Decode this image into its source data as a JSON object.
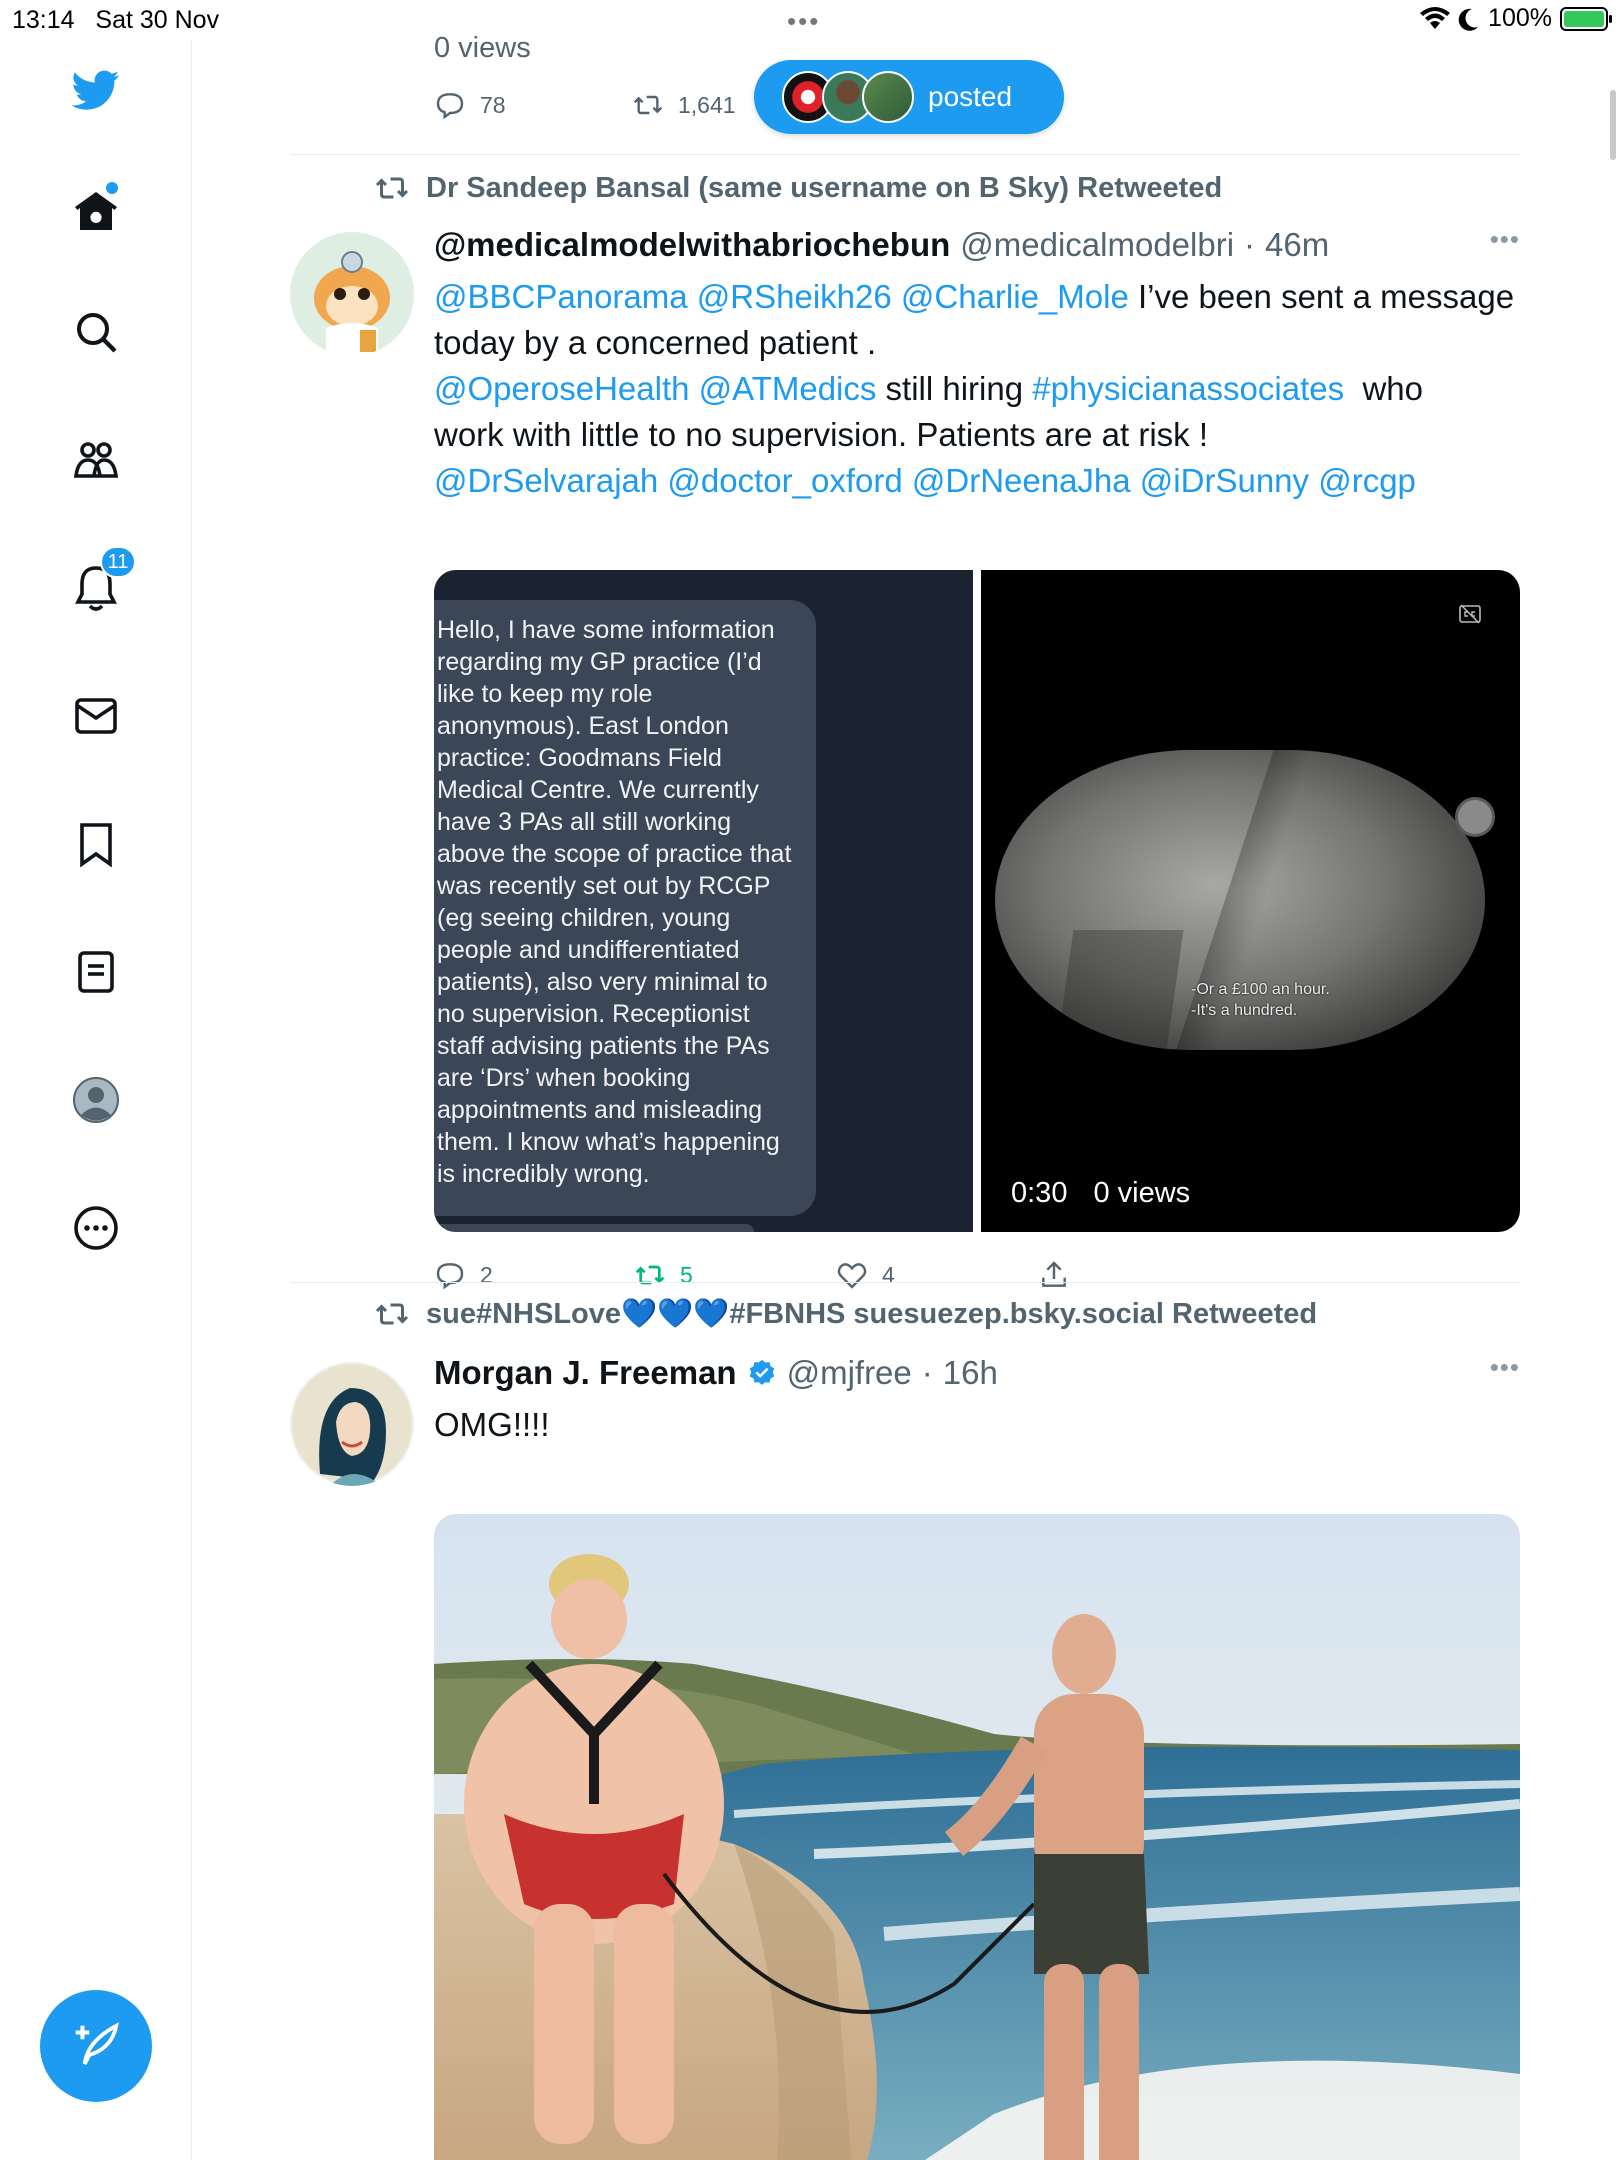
{
  "status_bar": {
    "time": "13:14",
    "date": "Sat 30 Nov",
    "battery": "100%"
  },
  "sidebar": {
    "notifications_badge": "11",
    "items": [
      "twitter-logo",
      "home-icon",
      "search-icon",
      "communities-icon",
      "bell-icon",
      "mail-icon",
      "bookmark-icon",
      "lists-icon",
      "profile-icon",
      "more-icon",
      "compose-icon"
    ]
  },
  "top_tweet": {
    "views": "0 views",
    "replies": "78",
    "retweets": "1,641"
  },
  "posted_pill": {
    "label": "posted"
  },
  "tweets": [
    {
      "retweeted_by": "Dr Sandeep Bansal (same username on B Sky) Retweeted",
      "name": "@medicalmodelwithabriochebun",
      "handle": "@medicalmodelbri",
      "age": "46m",
      "text_lines": [
        [
          "@BBCPanorama @RSheikh26 @Charlie_Mole",
          " I’ve been sent a message"
        ],
        [
          "today by a concerned patient ."
        ],
        [
          "@OperoseHealth @ATMedics",
          " still hiring ",
          "#physicianassociates",
          "  who"
        ],
        [
          "work with little to no supervision. Patients are at risk !"
        ],
        [
          "@DrSelvarajah @doctor_oxford @DrNeenaJha @iDrSunny @rcgp"
        ]
      ],
      "message_text": "Hello, I have some information regarding my GP practice (I’d like to keep my role anonymous). East London practice: Goodmans Field Medical Centre. We currently have 3 PAs all still working above the scope of practice that was recently set out by RCGP (eg seeing children, young people and undifferentiated patients), also very minimal to no supervision. Receptionist staff advising patients the PAs are ‘Drs’ when booking appointments and misleading them. I know what’s happening is incredibly wrong.",
      "video_caption_1": "-Or a £100 an hour.",
      "video_caption_2": "-It's a hundred.",
      "video_duration": "0:30",
      "video_views": "0 views",
      "replies": "2",
      "retweets": "5",
      "likes": "4"
    },
    {
      "retweeted_by": "sue#NHSLove💙💙💙#FBNHS suesuezep.bsky.social Retweeted",
      "name": "Morgan J. Freeman",
      "handle": "@mjfree",
      "age": "16h",
      "text": "OMG!!!!"
    }
  ],
  "colors": {
    "accent": "#1d9bf0",
    "retweet_green": "#00ba7c",
    "secondary_text": "#536471"
  }
}
